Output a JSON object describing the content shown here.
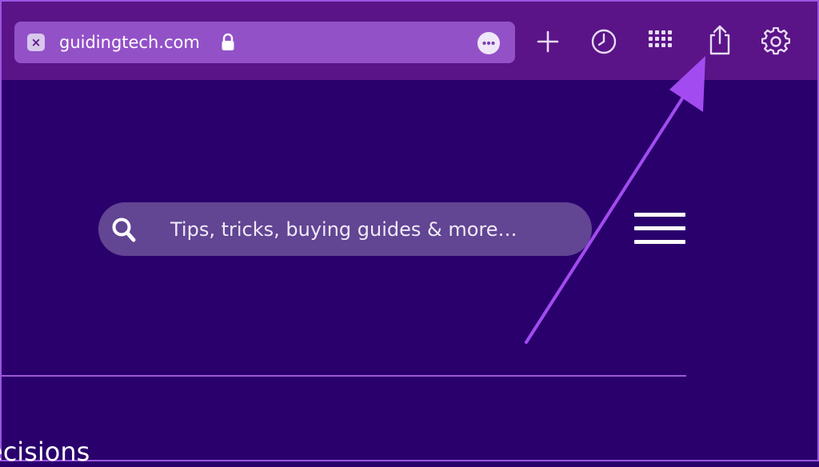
{
  "browser": {
    "url": "guidingtech.com",
    "favicon_glyph": "×",
    "toolbar_icons": [
      "plus-icon",
      "history-icon",
      "grid-icon",
      "share-icon",
      "gear-icon"
    ]
  },
  "page": {
    "search_placeholder": "Tips, tricks, buying guides & more…",
    "bottom_text": "ecisions"
  },
  "colors": {
    "toolbar_bg": "#5a1487",
    "page_bg": "#2a006c",
    "url_bar_bg": "#9351c8",
    "search_bg": "#624593",
    "arrow": "#a24bf0"
  }
}
